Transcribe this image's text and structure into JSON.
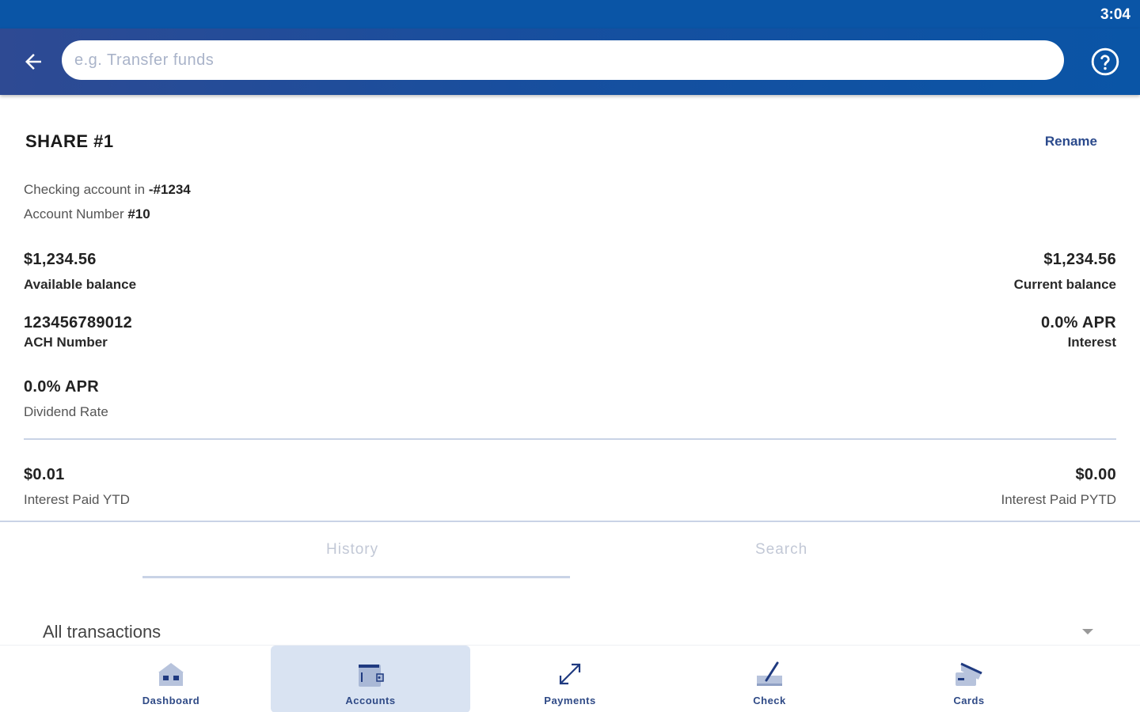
{
  "status_bar": {
    "time": "3:04"
  },
  "header": {
    "search_placeholder": "e.g. Transfer funds",
    "icons": {
      "back": "arrow-back-icon",
      "help": "help-circle-icon"
    }
  },
  "account": {
    "title": "SHARE #1",
    "rename_label": "Rename",
    "checking_prefix": "Checking account in ",
    "checking_number": "-#1234",
    "account_number_prefix": "Account Number ",
    "account_number": "#10"
  },
  "details": {
    "available_balance": {
      "value": "$1,234.56",
      "label": "Available balance"
    },
    "current_balance": {
      "value": "$1,234.56",
      "label": "Current balance"
    },
    "ach_number": {
      "value": "123456789012",
      "label": "ACH Number"
    },
    "interest": {
      "value": "0.0% APR",
      "label": "Interest"
    },
    "dividend_rate": {
      "value": "0.0% APR",
      "label": "Dividend Rate"
    },
    "interest_paid_ytd": {
      "value": "$0.01",
      "label": "Interest Paid YTD"
    },
    "interest_paid_pytd": {
      "value": "$0.00",
      "label": "Interest Paid PYTD"
    }
  },
  "tabs": [
    {
      "label": "History",
      "selected": true
    },
    {
      "label": "Search",
      "selected": false
    }
  ],
  "filter": {
    "selected": "All transactions"
  },
  "bottom_nav": [
    {
      "label": "Dashboard",
      "icon": "dashboard-icon",
      "active": false
    },
    {
      "label": "Accounts",
      "icon": "wallet-icon",
      "active": true
    },
    {
      "label": "Payments",
      "icon": "transfer-arrows-icon",
      "active": false
    },
    {
      "label": "Check",
      "icon": "check-deposit-icon",
      "active": false
    },
    {
      "label": "Cards",
      "icon": "cards-icon",
      "active": false
    }
  ],
  "colors": {
    "status_bar": "#0a55a6",
    "app_bar": "#2e4a93",
    "accent_text": "#2b4a8c",
    "nav_active_bg": "#d9e3f2",
    "divider": "#c9d3e6"
  }
}
